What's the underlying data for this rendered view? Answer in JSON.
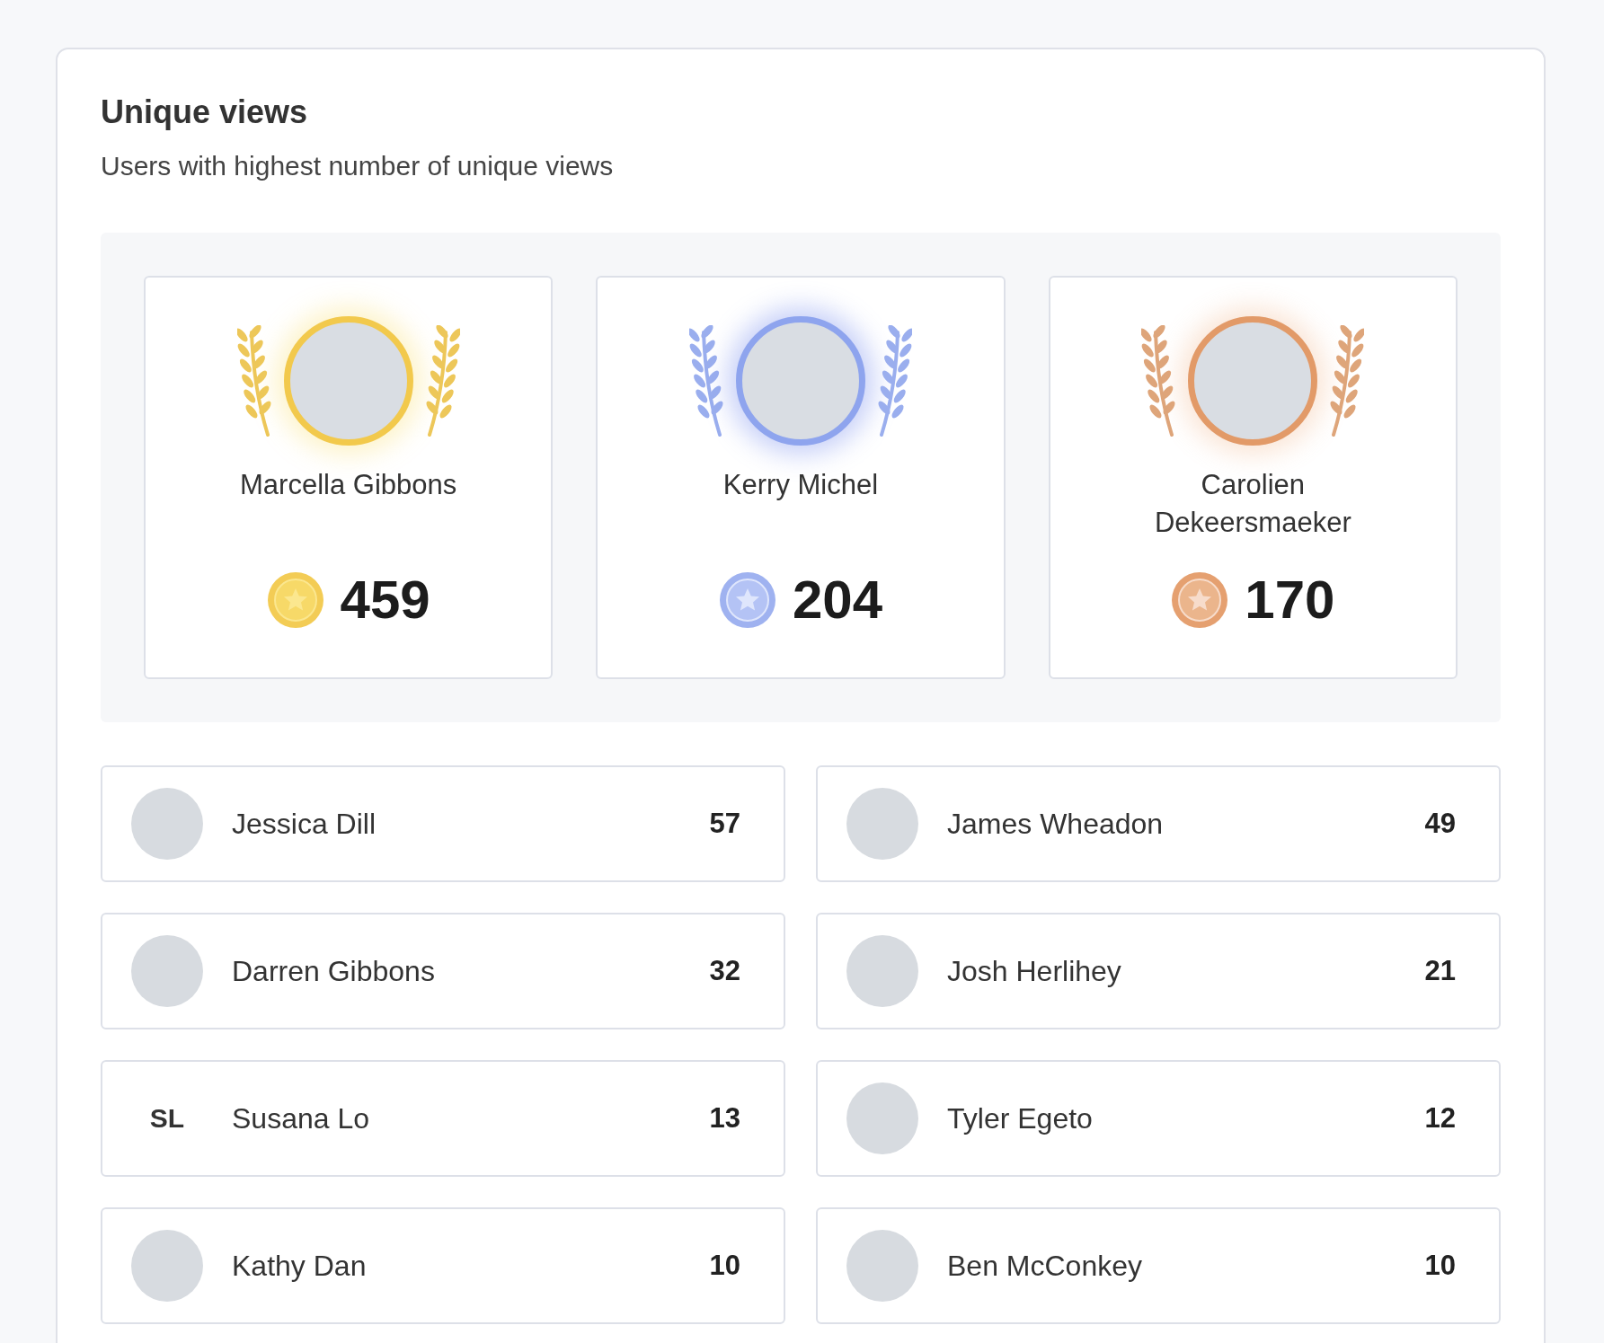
{
  "header": {
    "title": "Unique views",
    "subtitle": "Users with highest number of unique views"
  },
  "podium": [
    {
      "kind": "gold",
      "name": "Marcella Gibbons",
      "views": "459"
    },
    {
      "kind": "silver",
      "name": "Kerry Michel",
      "views": "204"
    },
    {
      "kind": "bronze",
      "name": "Carolien Dekeersmaeker",
      "views": "170"
    }
  ],
  "leaders": [
    {
      "kind": "photo",
      "name": "Jessica Dill",
      "views": "57"
    },
    {
      "kind": "photo",
      "name": "James Wheadon",
      "views": "49"
    },
    {
      "kind": "photo",
      "name": "Darren Gibbons",
      "views": "32"
    },
    {
      "kind": "photo",
      "name": "Josh Herlihey",
      "views": "21"
    },
    {
      "kind": "initials",
      "initials": "SL",
      "name": "Susana Lo",
      "views": "13"
    },
    {
      "kind": "photo",
      "name": "Tyler Egeto",
      "views": "12"
    },
    {
      "kind": "photo",
      "name": "Kathy Dan",
      "views": "10"
    },
    {
      "kind": "photo",
      "name": "Ben McConkey",
      "views": "10"
    }
  ]
}
